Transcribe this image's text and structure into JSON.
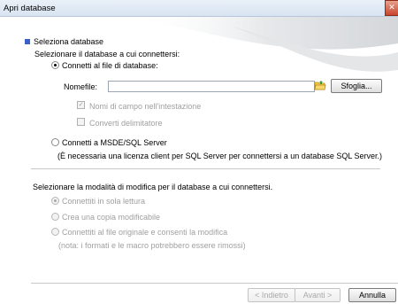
{
  "window": {
    "title": "Apri database",
    "close_glyph": "✕"
  },
  "section": {
    "title": "Seleziona database",
    "marker_color": "#3a5fc8"
  },
  "db": {
    "prompt": "Selezionare il database a cui connettersi:",
    "option_file": "Connetti al file di database:",
    "filename_label": "Nomefile:",
    "filename_value": "",
    "browse_button": "Sfoglia...",
    "check_field_names": "Nomi di campo nell'intestazione",
    "check_delimiter": "Converti delimitatore",
    "option_msde": "Connetti a MSDE/SQL Server",
    "msde_note": "(È necessaria una licenza client per SQL Server per connettersi a un database SQL Server.)"
  },
  "mode": {
    "prompt": "Selezionare la modalità di modifica per il database a cui connettersi.",
    "readonly": "Connettiti in sola lettura",
    "copy": "Crea una copia modificabile",
    "original": "Connettiti al file originale e consenti la modifica",
    "original_note": "(nota: i formati e le macro potrebbero essere rimossi)"
  },
  "footer": {
    "back": "< Indietro",
    "next": "Avanti >",
    "cancel": "Annulla"
  }
}
